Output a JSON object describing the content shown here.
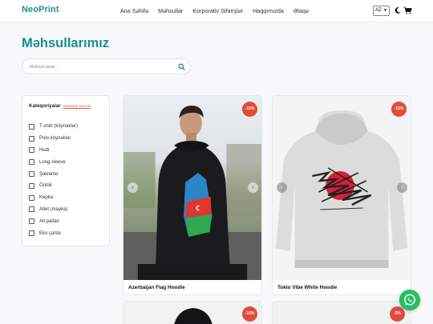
{
  "header": {
    "logo": "NeoPrint",
    "nav": [
      "Ana Səhifə",
      "Məhsullar",
      "Korporativ Sifarişlər",
      "Haqqımızda",
      "Əlaqə"
    ],
    "language": "AZ",
    "icons": [
      "moon-icon",
      "cart-icon"
    ]
  },
  "main": {
    "title": "Məhsullarımız",
    "search_placeholder": "Məhsul axtar..."
  },
  "sidebar": {
    "title": "Kateqoriyalar",
    "clear_label": "Seçimləri təmizlə",
    "categories": [
      "T-shirt (köynəklər)",
      "Polo köynəklər",
      "Hudi",
      "Long-sleeve",
      "Şalvarlar",
      "Önlük",
      "Kepka",
      "Atlet (mayka)",
      "Alt paltarı",
      "Eko çanta"
    ]
  },
  "products": [
    {
      "name": "Azerbaijan Flag Hoodie",
      "discount": "-15%"
    },
    {
      "name": "Tokio Vibe White Hoodie",
      "discount": "-15%"
    },
    {
      "name": "",
      "discount": "-15%"
    },
    {
      "name": "",
      "discount": "-5%"
    }
  ],
  "colors": {
    "brand": "#1b8f8c",
    "badge": "#e24b3c",
    "whatsapp": "#25c063"
  }
}
